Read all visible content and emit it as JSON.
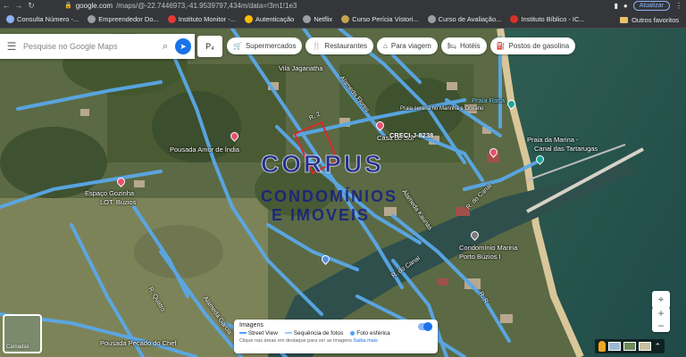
{
  "browser": {
    "url_host": "google.com",
    "url_path": "/maps/@-22.7446973,-41.9539797,434m/data=!3m1!1e3",
    "update_label": "Atualizar",
    "bookmarks": [
      {
        "label": "Consulta Número -...",
        "color": "#8ab4f8"
      },
      {
        "label": "Empreendedor Do...",
        "color": "#9aa0a6"
      },
      {
        "label": "Instituto Monitor -...",
        "color": "#e53935"
      },
      {
        "label": "Autenticação",
        "color": "#fbbc04"
      },
      {
        "label": "Netflix",
        "color": "#9aa0a6"
      },
      {
        "label": "Curso Perícia Vistori...",
        "color": "#c5a34f"
      },
      {
        "label": "Curso de Avaliação...",
        "color": "#9aa0a6"
      },
      {
        "label": "Instituto Bíblico - IC...",
        "color": "#d93025"
      }
    ],
    "other_favorites": "Outros favoritos"
  },
  "search": {
    "placeholder": "Pesquise no Google Maps",
    "p_button": "P₄"
  },
  "chips": [
    {
      "icon": "🛒",
      "label": "Supermercados"
    },
    {
      "icon": "🍴",
      "label": "Restaurantes"
    },
    {
      "icon": "⌂",
      "label": "Para viagem"
    },
    {
      "icon": "🛏",
      "label": "Hotéis"
    },
    {
      "icon": "⛽",
      "label": "Postos de gasolina"
    }
  ],
  "watermark": {
    "corpus": "CORPUS",
    "line1": "CONDOMÍNIOS",
    "line2": "E IMOVEIS",
    "creci": "CRECI-J-8238"
  },
  "map_labels": {
    "vila": "Vila Jaganatha",
    "alameda_flores": "Alameda Flores",
    "pousada_amor": "Pousada Amor de Índia",
    "espaco": "Espaço Gozinha",
    "espaco2": "LOT. Búzios",
    "praia_rasa": "Praia Rasa",
    "rasa_desc": "Praia serena no Marinha e Oceano",
    "casa_sub": "Casa do Sol",
    "praia_marina": "Praia da Marina -",
    "canal_tartarugas": "Canal das Tartarugas",
    "condominio": "Condomínio Marina",
    "condominio2": "Porto Búzios I",
    "rua_canal": "R. do Canal",
    "rua_canal2": "R. do Canal",
    "alameda_kaunas": "Alameda Kaunas",
    "alameda_garcia": "Alameda Garcia",
    "rua_quatro": "R. Quatro",
    "r_dois": "R. 2",
    "pousada_pecado": "Pousada Pecado do Chef",
    "r_r": "R. R"
  },
  "layers": {
    "label": "Camadas"
  },
  "images_panel": {
    "title": "Imagens",
    "street_view": "Street View",
    "sequencia": "Sequência de fotos",
    "foto_esferica": "Foto esférica",
    "note": "Clique nas áreas em destaque para ver as imagens",
    "saiba_mais": "Saiba mais"
  },
  "controls": {
    "locate": "⌖",
    "zoom_in": "+",
    "zoom_out": "−"
  }
}
